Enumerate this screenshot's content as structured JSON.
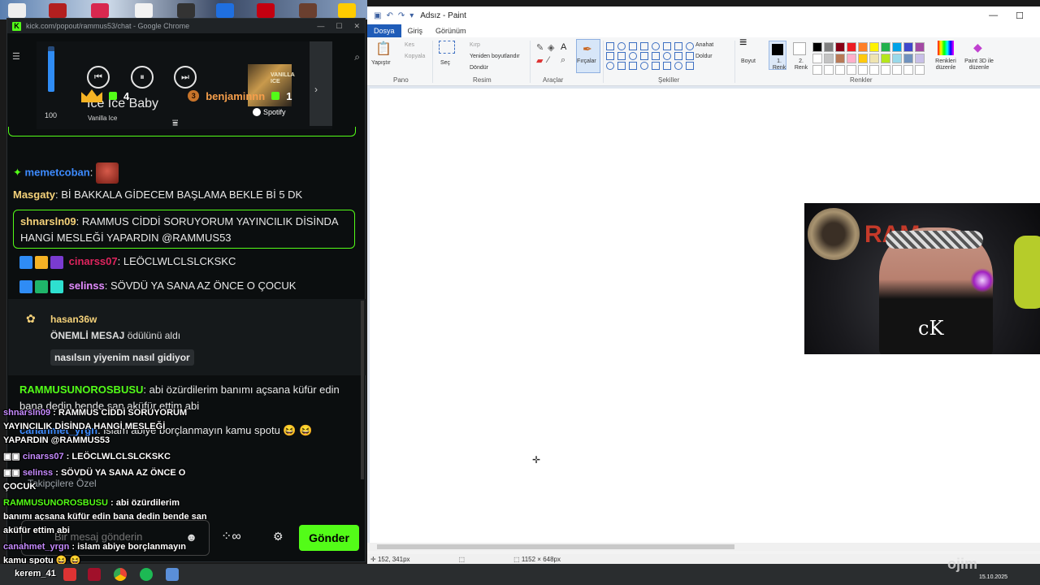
{
  "chrome": {
    "title": "kick.com/popout/rammus53/chat - Google Chrome",
    "win_controls": [
      "—",
      "☐",
      "✕"
    ]
  },
  "spotify": {
    "volume_value": 100,
    "volume_fraction": 0.9,
    "song_title": "Ice Ice Baby",
    "artist": "Vanilla Ice",
    "album_text": "VANILLA ICE",
    "brand": "Spotify",
    "prev_icon": "previous-icon",
    "pause_icon": "pause-icon",
    "next_icon": "next-icon"
  },
  "leaderboard": {
    "first_count": "4",
    "third_rank": "3",
    "third_user": "benjaminnn",
    "third_count": "1"
  },
  "messages": [
    {
      "user": "memetcoban",
      "color": "#3d8bff",
      "text": ""
    },
    {
      "user": "Masgaty",
      "color": "#f5d27a",
      "text": "Bİ BAKKALA GİDECEM BAŞLAMA BEKLE Bİ 5 DK"
    },
    {
      "user": "shnarsln09",
      "color": "#f5d27a",
      "text": "RAMMUS CİDDİ SORUYORUM YAYINCILIK DİSİNDA HANGİ MESLEĞİ YAPARDIN @RAMMUS53"
    },
    {
      "user": "cinarss07",
      "color": "#e0245e",
      "text": "LEÖCLWLCLSLCKSKC"
    },
    {
      "user": "selinss",
      "color": "#e38cff",
      "text": "SÖVDÜ YA SANA AZ ÖNCE O ÇOCUK"
    },
    {
      "user": "RAMMUSUNOROSBUSU",
      "color": "#53fc18",
      "text": "abi özürdilerim banımı açsana küfür edin bana dedin bende san aküfür ettim abi"
    },
    {
      "user": "canahmet_yrgn",
      "color": "#3d8bff",
      "text": "islam abiye borçlanmayın kamu spotu 😆 😆"
    }
  ],
  "system": {
    "user": "hasan36w",
    "action_bold": "ÖNEMLİ MESAJ",
    "action_rest": "ödülünü aldı",
    "message": "nasılsın yiyenim nasıl gidiyor"
  },
  "overlay": {
    "l1_user": "shnarsln09",
    "l1_text": "RAMMUS CİDDİ SORUYORUM",
    "l2": "YAYINCILIK DİSİNDA HANGİ MESLEĞİ",
    "l3": "YAPARDIN @RAMMUS53",
    "l4_user": "cinarss07",
    "l4_text": "LEÖCLWLCLSLCKSKC",
    "l5_user": "selinss",
    "l5_text": "SÖVDÜ YA SANA AZ ÖNCE O",
    "l6": "ÇOCUK",
    "l7_user": "RAMMUSUNOROSBUSU",
    "l7_text": "abi özürdilerim",
    "l8": "banımı açsana küfür edin bana dedin bende san",
    "l9": "aküfür ettim abi",
    "l10_user": "canahmet_yrgn",
    "l10_text": "islam abiye borçlanmayın",
    "l11": "kamu spotu 😆 😆",
    "tb_user": "kerem_41"
  },
  "followers_only": "Takipçilere Özel",
  "input": {
    "placeholder": "Bir mesaj gönderin",
    "send_label": "Gönder"
  },
  "paint": {
    "title": "Adsız - Paint",
    "tabs": [
      "Dosya",
      "Giriş",
      "Görünüm"
    ],
    "groups": {
      "pano": "Pano",
      "resim": "Resim",
      "araclar": "Araçlar",
      "sekiller": "Şekiller",
      "renkler": "Renkler"
    },
    "items": {
      "paste": "Yapıştır",
      "cut": "Kes",
      "copy": "Kopyala",
      "select": "Seç",
      "crop": "Kırp",
      "resize": "Yeniden boyutlandır",
      "rotate": "Döndür",
      "brushes": "Fırçalar",
      "outline": "Anahat",
      "fill": "Doldur",
      "size": "Boyut",
      "color1": "1. Renk",
      "color2": "2. Renk",
      "edit_colors": "Renkleri düzenle",
      "paint3d": "Paint 3D ile düzenle"
    },
    "palette": [
      "#000000",
      "#7f7f7f",
      "#880015",
      "#ed1c24",
      "#ff7f27",
      "#fff200",
      "#22b14c",
      "#00a2e8",
      "#3f48cc",
      "#a349a4",
      "#ffffff",
      "#c3c3c3",
      "#b97a57",
      "#ffaec9",
      "#ffc90e",
      "#efe4b0",
      "#b5e61d",
      "#99d9ea",
      "#7092be",
      "#c8bfe7",
      "#ffffff",
      "#ffffff",
      "#ffffff",
      "#ffffff",
      "#ffffff",
      "#ffffff",
      "#ffffff",
      "#ffffff",
      "#ffffff",
      "#ffffff"
    ],
    "status_pos": "152, 341px",
    "status_size": "1152 × 648px"
  },
  "webcam": {
    "sign_text": "RAM",
    "shirt_logo": "cK"
  },
  "taskbar": {
    "date": "15.10.2025"
  },
  "colors": {
    "kick_green": "#53fc18",
    "paint_accent": "#1f5cb8"
  }
}
